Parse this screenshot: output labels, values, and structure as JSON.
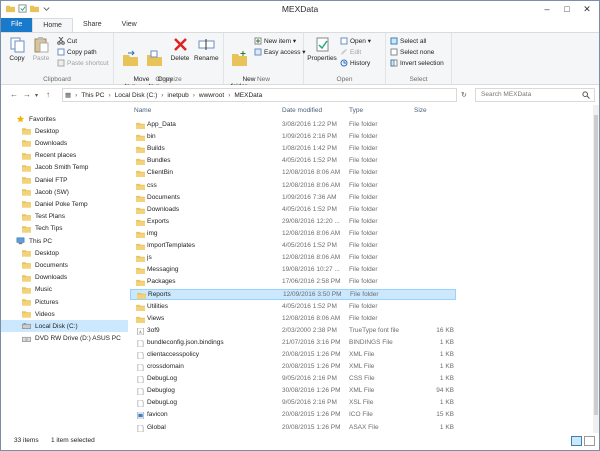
{
  "window": {
    "title": "MEXData"
  },
  "ribbon_tabs": [
    "File",
    "Home",
    "Share",
    "View"
  ],
  "clipboard": {
    "label": "Clipboard",
    "copy": "Copy",
    "paste": "Paste",
    "cut": "Cut",
    "copy_path": "Copy path",
    "paste_shortcut": "Paste shortcut"
  },
  "organize": {
    "label": "Organize",
    "move_to": "Move\nto ▾",
    "copy_to": "Copy\nto ▾",
    "delete": "Delete",
    "rename": "Rename"
  },
  "new_group": {
    "label": "New",
    "new_folder": "New\nfolder",
    "new_item": "New item ▾",
    "easy_access": "Easy access ▾"
  },
  "open_group": {
    "label": "Open",
    "properties": "Properties",
    "open": "Open ▾",
    "edit": "Edit",
    "history": "History"
  },
  "select_group": {
    "label": "Select",
    "select_all": "Select all",
    "select_none": "Select none",
    "invert_selection": "Invert selection"
  },
  "address": {
    "crumbs": [
      "This PC",
      "Local Disk (C:)",
      "inetpub",
      "wwwroot",
      "MEXData"
    ],
    "search_placeholder": "Search MEXData"
  },
  "nav": [
    {
      "label": "Favorites",
      "icon": "star",
      "level": 0
    },
    {
      "label": "Desktop",
      "icon": "folder",
      "level": 1
    },
    {
      "label": "Downloads",
      "icon": "folder",
      "level": 1
    },
    {
      "label": "Recent places",
      "icon": "folder",
      "level": 1
    },
    {
      "label": "Jacob Smith Temp",
      "icon": "folder",
      "level": 1
    },
    {
      "label": "Daniel FTP",
      "icon": "folder",
      "level": 1
    },
    {
      "label": "Jacob (SW)",
      "icon": "folder",
      "level": 1
    },
    {
      "label": "Daniel Poke Temp",
      "icon": "folder",
      "level": 1
    },
    {
      "label": "Test Plans",
      "icon": "folder",
      "level": 1
    },
    {
      "label": "Tech Tips",
      "icon": "folder",
      "level": 1
    },
    {
      "label": "This PC",
      "icon": "pc",
      "level": 0
    },
    {
      "label": "Desktop",
      "icon": "folder",
      "level": 1
    },
    {
      "label": "Documents",
      "icon": "folder",
      "level": 1
    },
    {
      "label": "Downloads",
      "icon": "folder",
      "level": 1
    },
    {
      "label": "Music",
      "icon": "folder",
      "level": 1
    },
    {
      "label": "Pictures",
      "icon": "folder",
      "level": 1
    },
    {
      "label": "Videos",
      "icon": "folder",
      "level": 1
    },
    {
      "label": "Local Disk (C:)",
      "icon": "disk",
      "level": 1,
      "selected": true
    },
    {
      "label": "DVD RW Drive (D:) ASUS PC",
      "icon": "dvd",
      "level": 1
    }
  ],
  "columns": {
    "name": "Name",
    "date": "Date modified",
    "type": "Type",
    "size": "Size"
  },
  "files": [
    {
      "name": "App_Data",
      "date": "3/08/2016 1:22 PM",
      "type": "File folder",
      "size": "",
      "icon": "folder"
    },
    {
      "name": "bin",
      "date": "1/09/2016 2:16 PM",
      "type": "File folder",
      "size": "",
      "icon": "folder"
    },
    {
      "name": "Builds",
      "date": "1/08/2016 1:42 PM",
      "type": "File folder",
      "size": "",
      "icon": "folder"
    },
    {
      "name": "Bundles",
      "date": "4/05/2016 1:52 PM",
      "type": "File folder",
      "size": "",
      "icon": "folder"
    },
    {
      "name": "ClientBin",
      "date": "12/08/2016 8:06 AM",
      "type": "File folder",
      "size": "",
      "icon": "folder"
    },
    {
      "name": "css",
      "date": "12/08/2016 8:06 AM",
      "type": "File folder",
      "size": "",
      "icon": "folder"
    },
    {
      "name": "Documents",
      "date": "1/09/2016 7:36 AM",
      "type": "File folder",
      "size": "",
      "icon": "folder"
    },
    {
      "name": "Downloads",
      "date": "4/05/2016 1:52 PM",
      "type": "File folder",
      "size": "",
      "icon": "folder"
    },
    {
      "name": "Exports",
      "date": "29/08/2016 12:20 ...",
      "type": "File folder",
      "size": "",
      "icon": "folder"
    },
    {
      "name": "img",
      "date": "12/08/2016 8:06 AM",
      "type": "File folder",
      "size": "",
      "icon": "folder"
    },
    {
      "name": "ImportTemplates",
      "date": "4/05/2016 1:52 PM",
      "type": "File folder",
      "size": "",
      "icon": "folder"
    },
    {
      "name": "js",
      "date": "12/08/2016 8:06 AM",
      "type": "File folder",
      "size": "",
      "icon": "folder"
    },
    {
      "name": "Messaging",
      "date": "19/08/2016 10:27 ...",
      "type": "File folder",
      "size": "",
      "icon": "folder"
    },
    {
      "name": "Packages",
      "date": "17/06/2016 2:58 PM",
      "type": "File folder",
      "size": "",
      "icon": "folder"
    },
    {
      "name": "Reports",
      "date": "12/09/2016 3:50 PM",
      "type": "File folder",
      "size": "",
      "icon": "folder",
      "selected": true
    },
    {
      "name": "Utilities",
      "date": "4/05/2016 1:52 PM",
      "type": "File folder",
      "size": "",
      "icon": "folder"
    },
    {
      "name": "Views",
      "date": "12/08/2016 8:06 AM",
      "type": "File folder",
      "size": "",
      "icon": "folder"
    },
    {
      "name": "3of9",
      "date": "2/03/2000 2:38 PM",
      "type": "TrueType font file",
      "size": "16 KB",
      "icon": "font"
    },
    {
      "name": "bundleconfig.json.bindings",
      "date": "21/07/2016 3:16 PM",
      "type": "BINDINGS File",
      "size": "1 KB",
      "icon": "file"
    },
    {
      "name": "clientaccesspolicy",
      "date": "20/08/2015 1:26 PM",
      "type": "XML File",
      "size": "1 KB",
      "icon": "file"
    },
    {
      "name": "crossdomain",
      "date": "20/08/2015 1:26 PM",
      "type": "XML File",
      "size": "1 KB",
      "icon": "file"
    },
    {
      "name": "DebugLog",
      "date": "9/05/2016 2:16 PM",
      "type": "CSS File",
      "size": "1 KB",
      "icon": "file"
    },
    {
      "name": "Debuglog",
      "date": "30/08/2016 1:26 PM",
      "type": "XML File",
      "size": "94 KB",
      "icon": "file"
    },
    {
      "name": "DebugLog",
      "date": "9/05/2016 2:16 PM",
      "type": "XSL File",
      "size": "1 KB",
      "icon": "file"
    },
    {
      "name": "favicon",
      "date": "20/08/2015 1:26 PM",
      "type": "ICO File",
      "size": "15 KB",
      "icon": "ico"
    },
    {
      "name": "Global",
      "date": "20/08/2015 1:26 PM",
      "type": "ASAX File",
      "size": "1 KB",
      "icon": "file"
    }
  ],
  "status": {
    "count": "33 items",
    "selected": "1 item selected"
  },
  "colors": {
    "accent": "#1979ca",
    "selection": "#cce8ff",
    "folder": "#e8c35a"
  }
}
